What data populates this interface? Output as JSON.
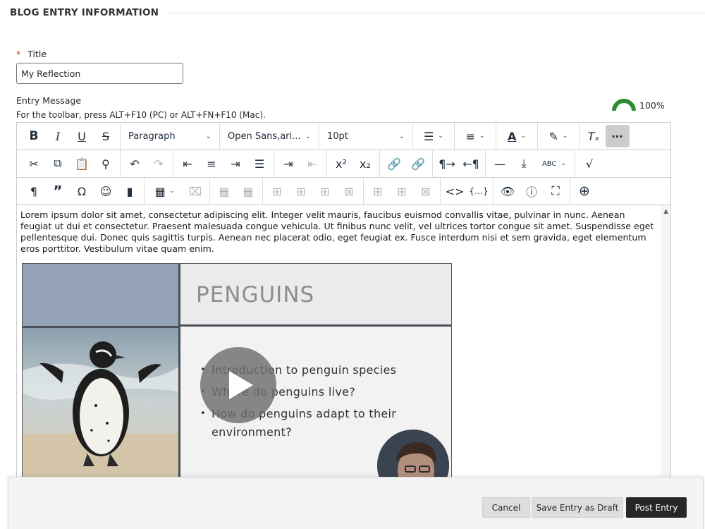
{
  "section": {
    "title": "BLOG ENTRY INFORMATION"
  },
  "title_field": {
    "required_marker": "*",
    "label": "Title",
    "value": "My Reflection"
  },
  "entry": {
    "label": "Entry Message",
    "toolbar_hint": "For the toolbar, press ALT+F10 (PC) or ALT+FN+F10 (Mac).",
    "completion_percent": "100%"
  },
  "toolbar": {
    "format_select": "Paragraph",
    "font_select": "Open Sans,ari...",
    "size_select": "10pt"
  },
  "content": {
    "paragraph": "Lorem ipsum dolor sit amet, consectetur adipiscing elit. Integer velit mauris, faucibus euismod convallis vitae, pulvinar in nunc. Aenean feugiat ut dui et consectetur. Praesent malesuada congue vehicula. Ut finibus nunc velit, vel ultrices tortor congue sit amet. Suspendisse eget pellentesque dui. Donec quis sagittis turpis. Aenean nec placerat odio, eget feugiat ex. Fusce interdum nisi et sem gravida, eget elementum eros porttitor. Vestibulum vitae quam enim.",
    "slide": {
      "title": "PENGUINS",
      "bullets": [
        "Introduction to penguin species",
        "Where do penguins live?",
        "How do penguins adapt to their environment?"
      ]
    }
  },
  "footer": {
    "cancel": "Cancel",
    "save_draft": "Save Entry as Draft",
    "post": "Post Entry"
  },
  "colors": {
    "accent_green": "#2e8b2e",
    "primary_button": "#262626",
    "required": "#c63c1c"
  }
}
